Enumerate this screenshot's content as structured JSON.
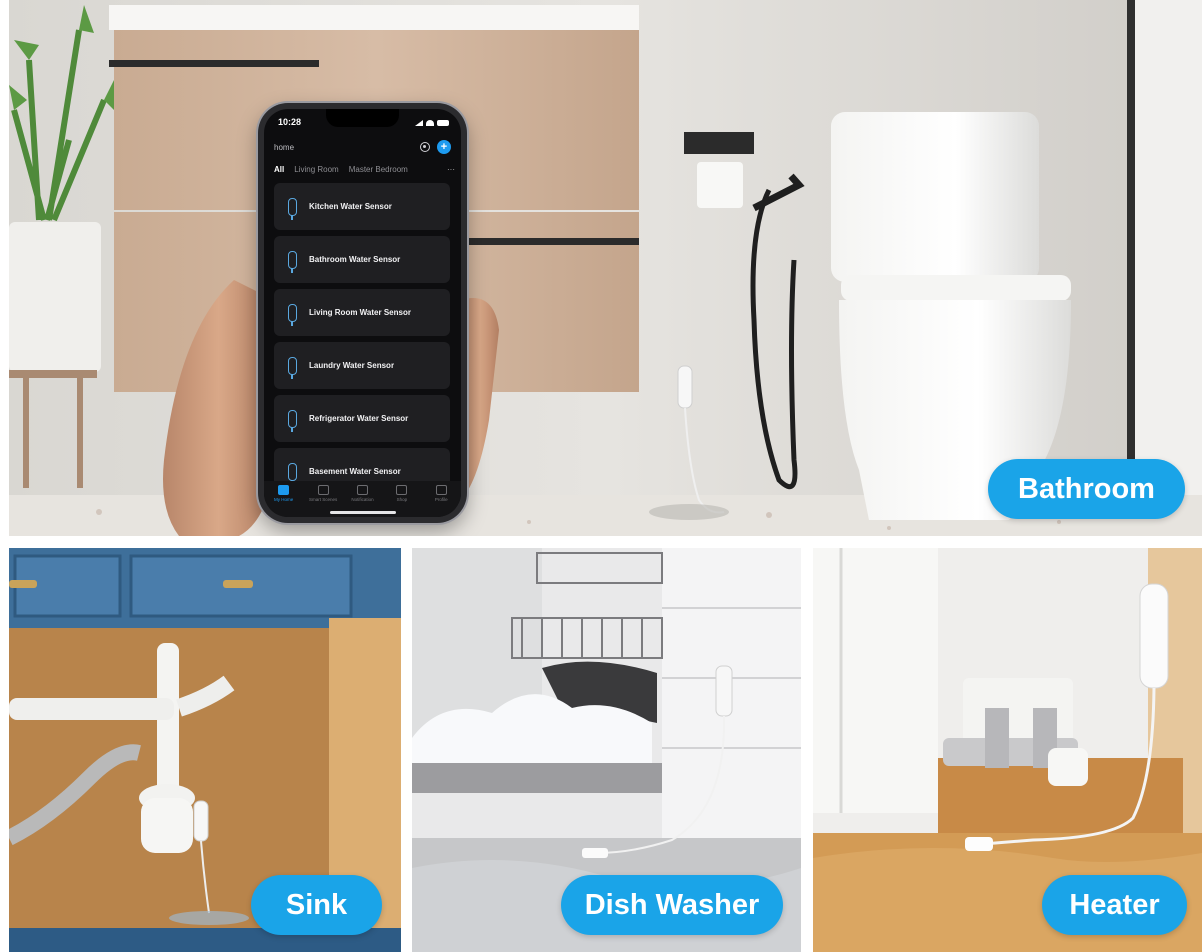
{
  "labels": {
    "bathroom": "Bathroom",
    "sink": "Sink",
    "dish_washer": "Dish Washer",
    "heater": "Heater"
  },
  "phone": {
    "time": "10:28",
    "home": "home",
    "add_symbol": "+",
    "tabs": [
      "All",
      "Living Room",
      "Master Bedroom"
    ],
    "more_symbol": "···",
    "devices": [
      "Kitchen Water Sensor",
      "Bathroom Water Sensor",
      "Living Room Water Sensor",
      "Laundry Water Sensor",
      "Refrigerator Water Sensor",
      "Basement Water Sensor"
    ],
    "bottom_tabs": [
      "My Home",
      "Smart Scenes",
      "Notification",
      "Shop",
      "Profile"
    ]
  },
  "colors": {
    "label_bg": "#1aa4e8",
    "label_text": "#ffffff",
    "phone_accent": "#1d9bf0",
    "screen_bg": "#0d0d0f"
  },
  "icons": [
    "camera-icon",
    "plus-icon",
    "water-sensor-icon",
    "home-tab-icon",
    "scenes-tab-icon",
    "notification-tab-icon",
    "shop-tab-icon",
    "profile-tab-icon"
  ]
}
